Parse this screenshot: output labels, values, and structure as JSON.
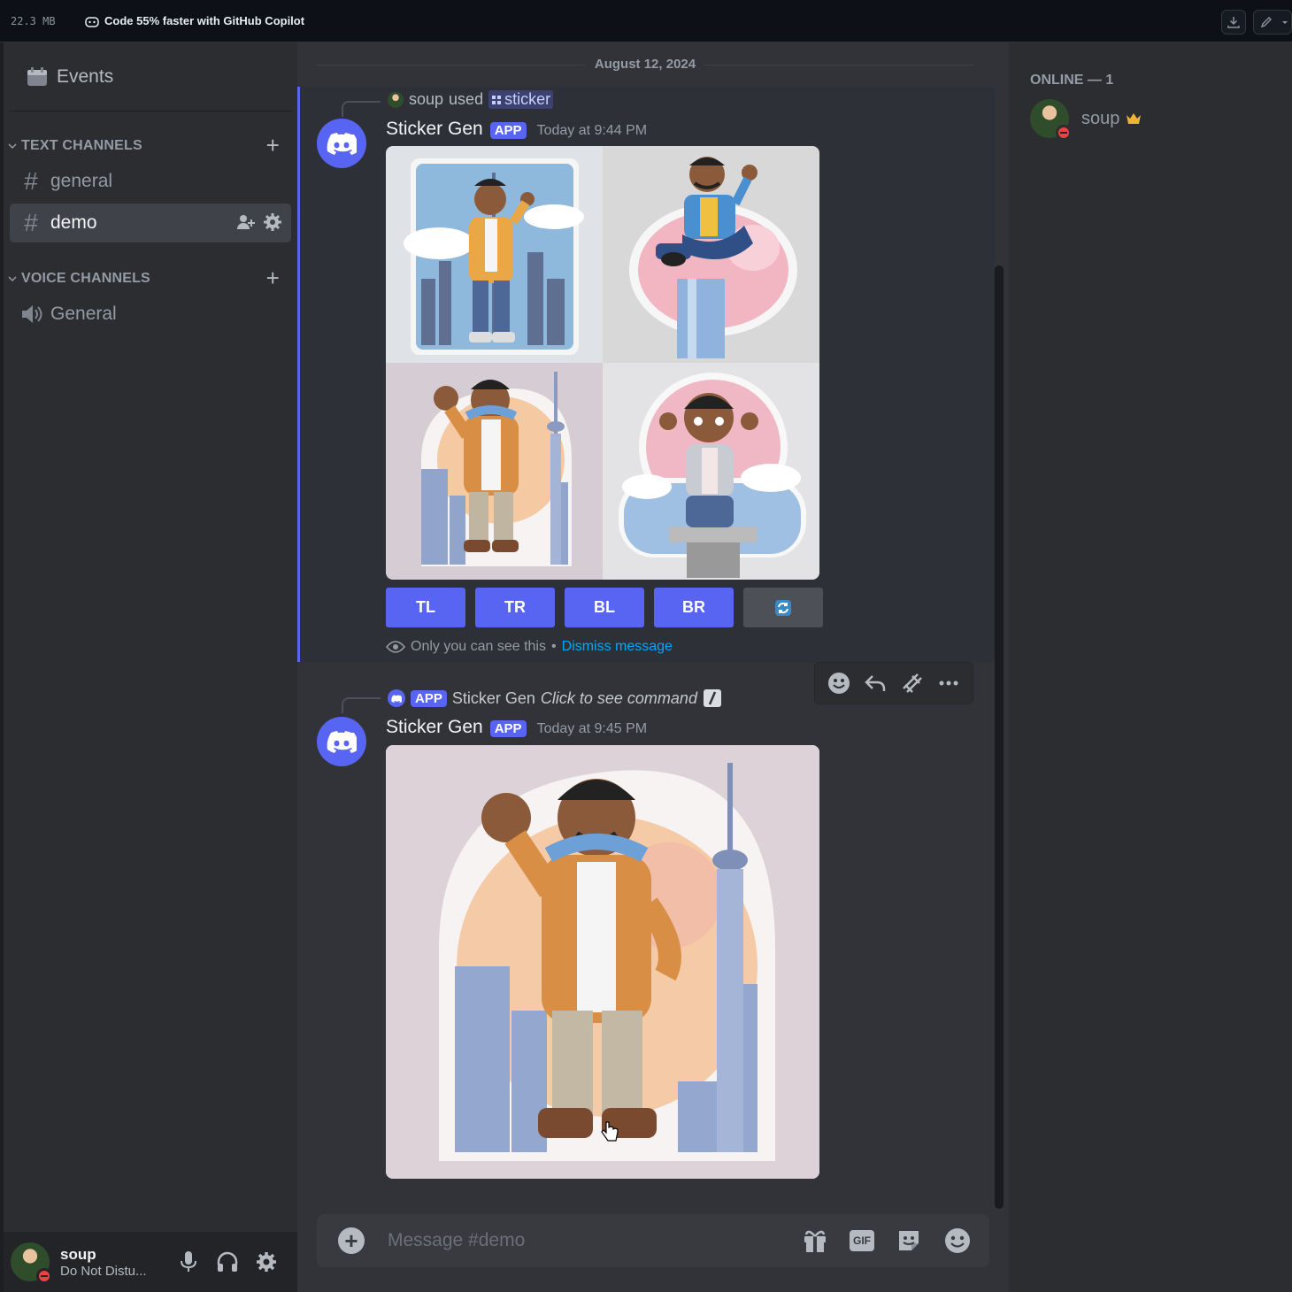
{
  "topbar": {
    "memory": "22.3 MB",
    "copilot_text": "Code 55% faster with GitHub Copilot"
  },
  "sidebar": {
    "events_label": "Events",
    "text_category": "TEXT CHANNELS",
    "voice_category": "VOICE CHANNELS",
    "text_channels": [
      {
        "name": "general",
        "active": false
      },
      {
        "name": "demo",
        "active": true
      }
    ],
    "voice_channels": [
      {
        "name": "General"
      }
    ]
  },
  "user_panel": {
    "username": "soup",
    "status": "Do Not Distu..."
  },
  "chat": {
    "date_divider": "August 12, 2024",
    "message1": {
      "context_user": "soup",
      "context_verb": "used",
      "context_command": "sticker",
      "author": "Sticker Gen",
      "tag": "APP",
      "time": "Today at 9:44 PM",
      "buttons": [
        "TL",
        "TR",
        "BL",
        "BR"
      ],
      "ephemeral_note": "Only you can see this",
      "separator": "•",
      "dismiss": "Dismiss message"
    },
    "message2": {
      "context_tag": "APP",
      "context_author": "Sticker Gen",
      "context_hint": "Click to see command",
      "author": "Sticker Gen",
      "tag": "APP",
      "time": "Today at 9:45 PM"
    },
    "composer_placeholder": "Message #demo",
    "composer_gif": "GIF"
  },
  "members": {
    "header": "ONLINE — 1",
    "list": [
      {
        "name": "soup",
        "owner": true
      }
    ]
  },
  "colors": {
    "blurple": "#5865f2",
    "dnd_red": "#f23f43",
    "link": "#00a8fc",
    "crown": "#f0b232"
  }
}
